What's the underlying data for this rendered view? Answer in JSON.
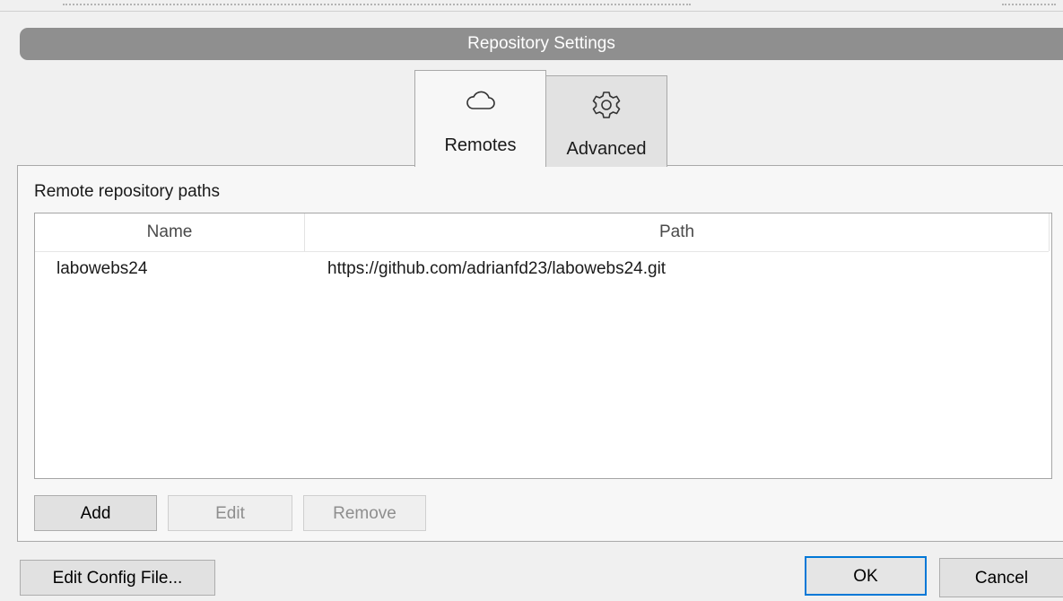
{
  "window": {
    "title": "Repository Settings"
  },
  "tabs": [
    {
      "label": "Remotes",
      "icon": "cloud-icon",
      "active": true
    },
    {
      "label": "Advanced",
      "icon": "gear-icon",
      "active": false
    }
  ],
  "remotes": {
    "section_label": "Remote repository paths",
    "columns": [
      "Name",
      "Path"
    ],
    "rows": [
      {
        "name": "labowebs24",
        "path": "https://github.com/adrianfd23/labowebs24.git"
      }
    ],
    "buttons": {
      "add": "Add",
      "edit": "Edit",
      "remove": "Remove"
    }
  },
  "footer": {
    "edit_config": "Edit Config File...",
    "ok": "OK",
    "cancel": "Cancel"
  },
  "colors": {
    "titlebar": "#8f8f8f",
    "focus_border": "#0078d7"
  }
}
